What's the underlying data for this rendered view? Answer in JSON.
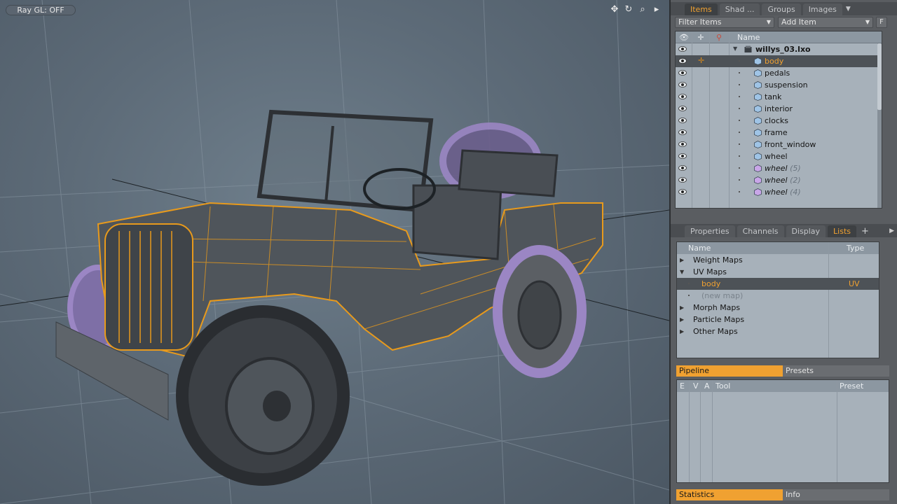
{
  "viewport": {
    "ray_gl_label": "Ray GL: OFF",
    "tool_icons": [
      "move-icon",
      "rotate-icon",
      "zoom-icon",
      "expand-icon"
    ]
  },
  "items_tabs": [
    {
      "label": "Items",
      "active": true
    },
    {
      "label": "Shad ...",
      "active": false
    },
    {
      "label": "Groups",
      "active": false
    },
    {
      "label": "Images",
      "active": false
    }
  ],
  "filter": {
    "label": "Filter Items",
    "add_label": "Add Item",
    "f_label": "F"
  },
  "items_header": {
    "name": "Name"
  },
  "items_tree": [
    {
      "label": "willys_03.lxo",
      "kind": "scene",
      "level": 0,
      "selected": false
    },
    {
      "label": "body",
      "kind": "mesh",
      "level": 1,
      "selected": true
    },
    {
      "label": "pedals",
      "kind": "mesh",
      "level": 1,
      "selected": false
    },
    {
      "label": "suspension",
      "kind": "mesh",
      "level": 1,
      "selected": false
    },
    {
      "label": "tank",
      "kind": "mesh",
      "level": 1,
      "selected": false
    },
    {
      "label": "interior",
      "kind": "mesh",
      "level": 1,
      "selected": false
    },
    {
      "label": "clocks",
      "kind": "mesh",
      "level": 1,
      "selected": false
    },
    {
      "label": "frame",
      "kind": "mesh",
      "level": 1,
      "selected": false
    },
    {
      "label": "front_window",
      "kind": "mesh",
      "level": 1,
      "selected": false
    },
    {
      "label": "wheel",
      "kind": "mesh",
      "level": 1,
      "selected": false
    },
    {
      "label": "wheel",
      "count": "(5)",
      "kind": "instance",
      "level": 1,
      "selected": false
    },
    {
      "label": "wheel",
      "count": "(2)",
      "kind": "instance",
      "level": 1,
      "selected": false
    },
    {
      "label": "wheel",
      "count": "(4)",
      "kind": "instance",
      "level": 1,
      "selected": false
    }
  ],
  "props_tabs": [
    {
      "label": "Properties",
      "active": false
    },
    {
      "label": "Channels",
      "active": false
    },
    {
      "label": "Display",
      "active": false
    },
    {
      "label": "Lists",
      "active": true
    }
  ],
  "lists": {
    "header_name": "Name",
    "header_type": "Type",
    "rows": [
      {
        "label": "Weight Maps",
        "expanded": false,
        "indent": 0
      },
      {
        "label": "UV Maps",
        "expanded": true,
        "indent": 0
      },
      {
        "label": "body",
        "type": "UV",
        "indent": 1,
        "selected": true
      },
      {
        "label": "(new map)",
        "indent": 1,
        "dim": true
      },
      {
        "label": "Morph Maps",
        "expanded": false,
        "indent": 0
      },
      {
        "label": "Particle Maps",
        "expanded": false,
        "indent": 0
      },
      {
        "label": "Other Maps",
        "expanded": false,
        "indent": 0
      }
    ]
  },
  "pipeline": {
    "active_label": "Pipeline",
    "other_label": "Presets",
    "columns": [
      "E",
      "V",
      "A",
      "Tool",
      "Preset"
    ]
  },
  "stats": {
    "active_label": "Statistics",
    "other_label": "Info"
  },
  "colors": {
    "accent": "#f0a131",
    "selection": "#4d5257",
    "wire": "#e89a1c",
    "instance": "#9b86c4"
  }
}
